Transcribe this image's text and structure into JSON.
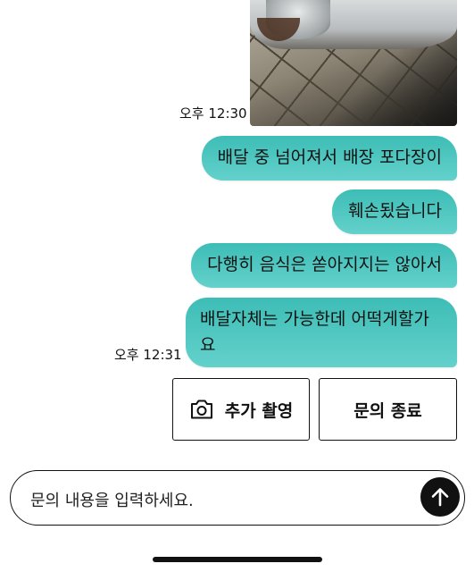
{
  "messages": [
    {
      "text": "배달 중 넘어져서 배장 포다장이"
    },
    {
      "text": "훼손됬습니다"
    },
    {
      "text": "다행히 음식은 쏟아지지는 않아서"
    },
    {
      "text": "배달자체는 가능한데 어떡게할가\n요"
    }
  ],
  "timestamps": {
    "photo_time": "오후 12:30",
    "last_time": "오후 12:31"
  },
  "actions": {
    "extra_photo_label": "추가 촬영",
    "end_inquiry_label": "문의 종료"
  },
  "input": {
    "placeholder": "문의 내용을 입력하세요."
  },
  "icons": {
    "camera": "camera-icon",
    "send": "arrow-up-icon"
  },
  "colors": {
    "bubble_top": "#3dbdb6",
    "bubble_bottom": "#64d1cb",
    "send_button": "#111111"
  }
}
